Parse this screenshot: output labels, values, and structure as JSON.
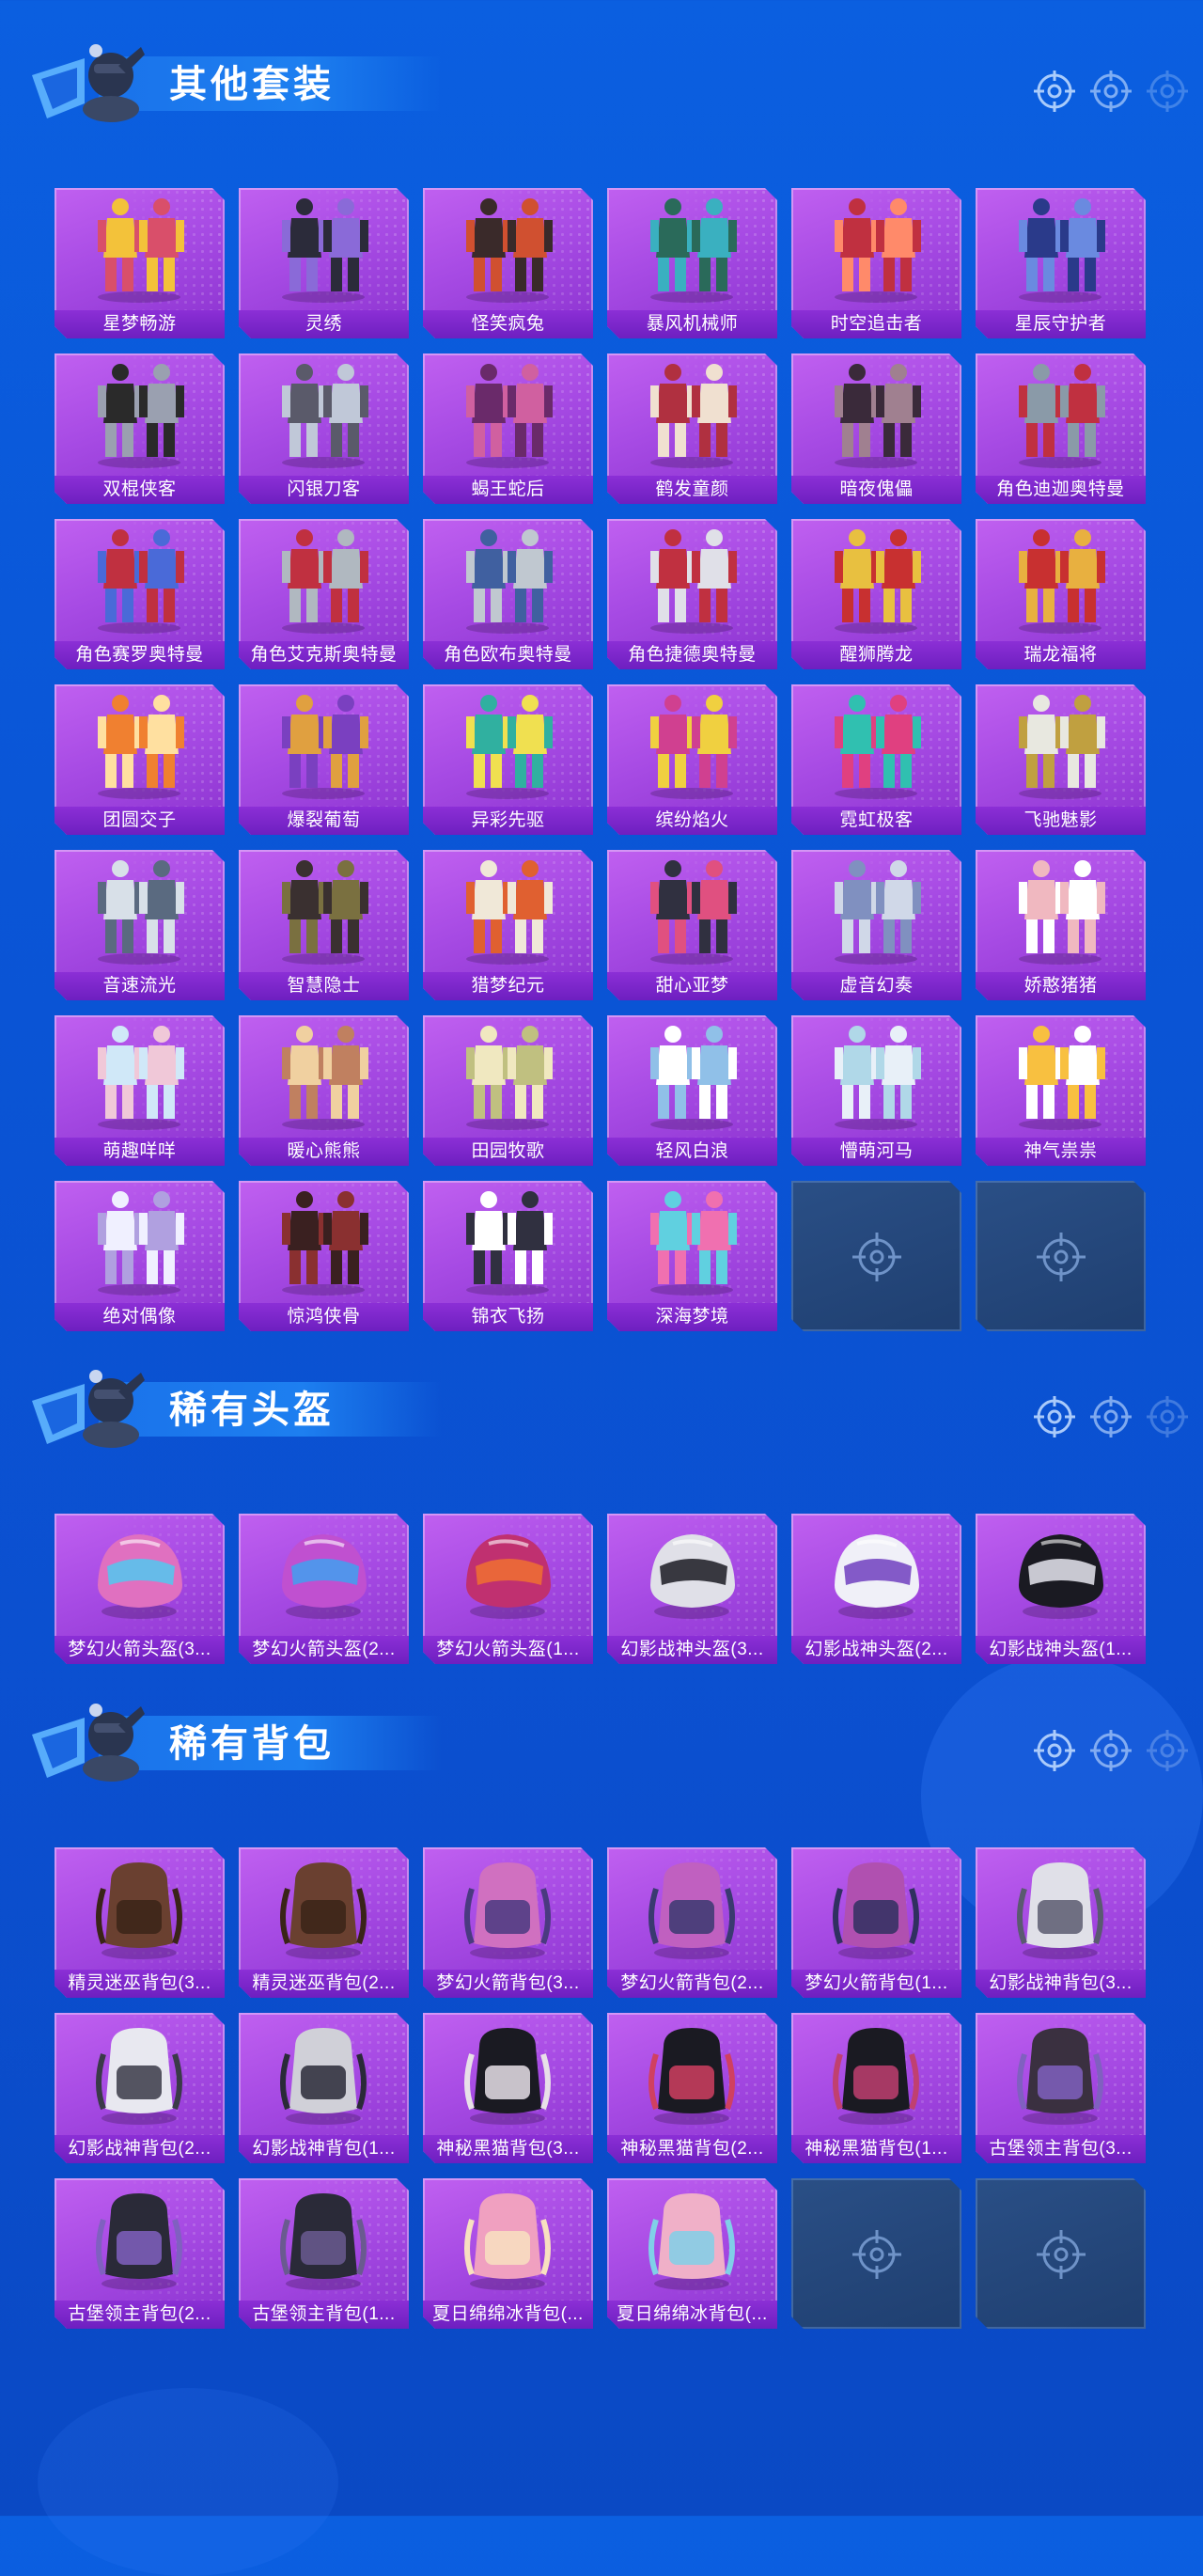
{
  "colors": {
    "background": "#0b5fe0",
    "card": "#a74be4",
    "label": "#7a26c8",
    "empty": "#23477c"
  },
  "sections": [
    {
      "title": "其他套装",
      "kind": "suit",
      "items": [
        "星梦畅游",
        "灵绣",
        "怪笑疯兔",
        "暴风机械师",
        "时空追击者",
        "星辰守护者",
        "双棍侠客",
        "闪银刀客",
        "蝎王蛇后",
        "鹤发童颜",
        "暗夜傀儡",
        "角色迪迦奥特曼",
        "角色赛罗奥特曼",
        "角色艾克斯奥特曼",
        "角色欧布奥特曼",
        "角色捷德奥特曼",
        "醒狮腾龙",
        "瑞龙福将",
        "团圆交子",
        "爆裂葡萄",
        "异彩先驱",
        "缤纷焰火",
        "霓虹极客",
        "飞驰魅影",
        "音速流光",
        "智慧隐士",
        "猎梦纪元",
        "甜心亚梦",
        "虚音幻奏",
        "娇憨猪猪",
        "萌趣咩咩",
        "暖心熊熊",
        "田园牧歌",
        "轻风白浪",
        "懵萌河马",
        "神气祟祟",
        "绝对偶像",
        "惊鸿侠骨",
        "锦衣飞扬",
        "深海梦境"
      ],
      "empty_slots": 2
    },
    {
      "title": "稀有头盔",
      "kind": "helmet",
      "items": [
        "梦幻火箭头盔(3...",
        "梦幻火箭头盔(2...",
        "梦幻火箭头盔(1...",
        "幻影战神头盔(3...",
        "幻影战神头盔(2...",
        "幻影战神头盔(1..."
      ],
      "empty_slots": 0
    },
    {
      "title": "稀有背包",
      "kind": "backpack",
      "items": [
        "精灵迷巫背包(3...",
        "精灵迷巫背包(2...",
        "梦幻火箭背包(3...",
        "梦幻火箭背包(2...",
        "梦幻火箭背包(1...",
        "幻影战神背包(3...",
        "幻影战神背包(2...",
        "幻影战神背包(1...",
        "神秘黑猫背包(3...",
        "神秘黑猫背包(2...",
        "神秘黑猫背包(1...",
        "古堡领主背包(3...",
        "古堡领主背包(2...",
        "古堡领主背包(1...",
        "夏日绵绵冰背包(...",
        "夏日绵绵冰背包(..."
      ],
      "empty_slots": 2
    }
  ]
}
